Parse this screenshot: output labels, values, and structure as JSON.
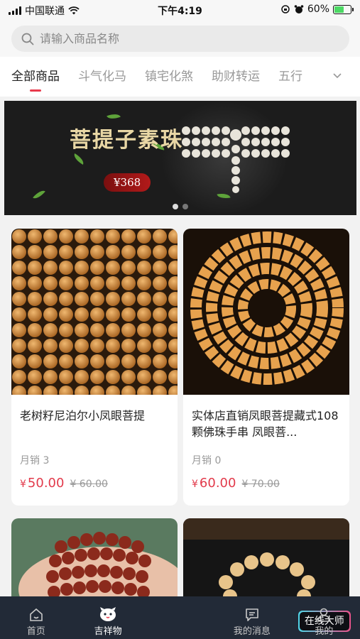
{
  "status_bar": {
    "carrier": "中国联通",
    "time": "下午4:19",
    "battery": "60%",
    "battery_level": 0.6
  },
  "search": {
    "placeholder": "请输入商品名称",
    "icon": "search-icon"
  },
  "tabs": [
    {
      "label": "全部商品",
      "active": true
    },
    {
      "label": "斗气化马",
      "active": false
    },
    {
      "label": "镇宅化煞",
      "active": false
    },
    {
      "label": "助财转运",
      "active": false
    },
    {
      "label": "五行",
      "active": false
    }
  ],
  "banner": {
    "title": "菩提子素珠",
    "price": "¥368",
    "slide_count": 2,
    "active_slide": 1
  },
  "products": [
    {
      "name": "老树籽尼泊尔小凤眼菩提",
      "sales": "月销 3",
      "price": "50.00",
      "currency": "¥",
      "original_price": "¥ 60.00"
    },
    {
      "name": "实体店直销凤眼菩提藏式108颗佛珠手串 凤眼菩...",
      "sales": "月销 0",
      "price": "60.00",
      "currency": "¥",
      "original_price": "¥ 70.00"
    }
  ],
  "tabbar": [
    {
      "label": "首页",
      "icon": "home-icon"
    },
    {
      "label": "吉祥物",
      "icon": "mascot-icon",
      "active": true
    },
    {
      "label": "在线大师",
      "icon": "center-button"
    },
    {
      "label": "我的消息",
      "icon": "message-icon"
    },
    {
      "label": "我的",
      "icon": "user-icon"
    }
  ],
  "colors": {
    "accent": "#e83a4c",
    "price": "#e23a4b",
    "tabbar_bg": "#222a37"
  }
}
